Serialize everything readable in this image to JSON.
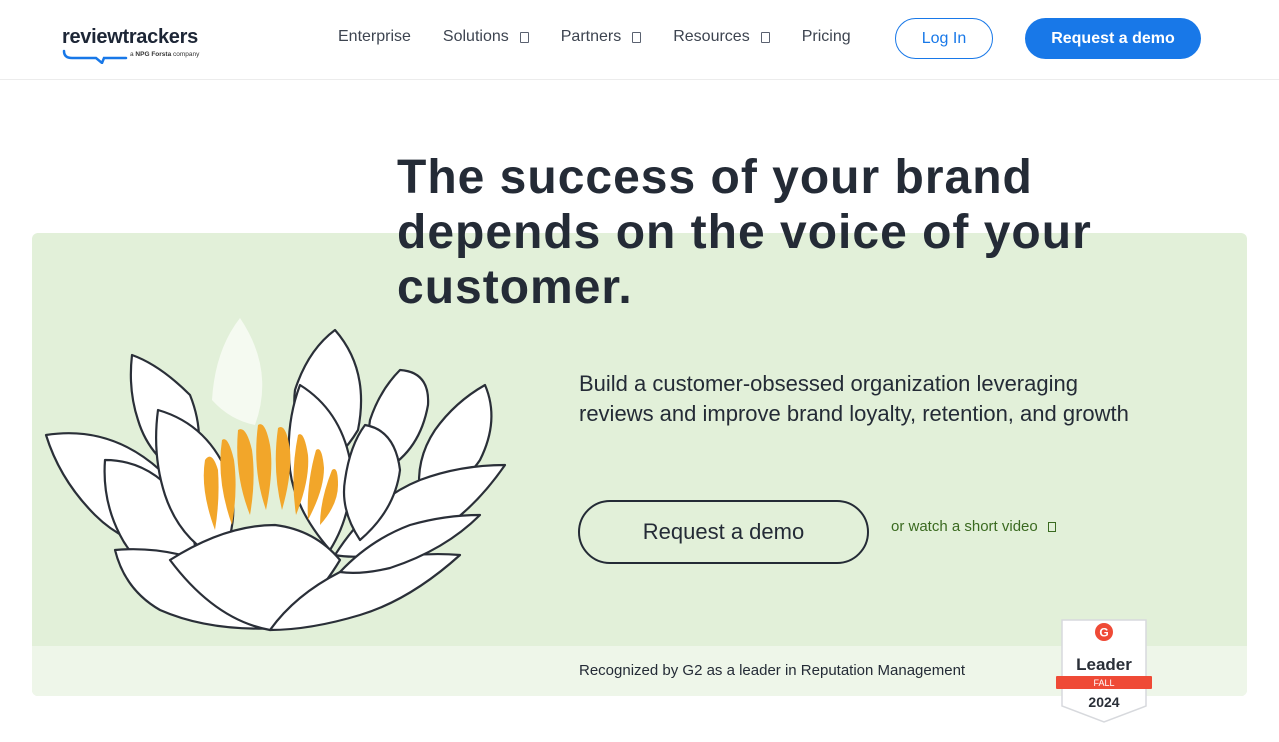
{
  "brand": {
    "name": "reviewtrackers",
    "sub_prefix": "a ",
    "sub_group": "NPG",
    "sub_company": "Forsta",
    "sub_suffix": " company",
    "accent": "#1878e8"
  },
  "nav": {
    "items": [
      {
        "label": "Enterprise",
        "dropdown": false
      },
      {
        "label": "Solutions",
        "dropdown": true
      },
      {
        "label": "Partners",
        "dropdown": true
      },
      {
        "label": "Resources",
        "dropdown": true
      },
      {
        "label": "Pricing",
        "dropdown": false
      }
    ],
    "login_label": "Log In",
    "demo_label": "Request a demo"
  },
  "hero": {
    "headline_lines": [
      "The success of your brand",
      "depends on the voice of your",
      "customer."
    ],
    "subtext": "Build a customer-obsessed organization leveraging reviews and improve brand loyalty, retention, and growth",
    "cta_label": "Request a demo",
    "video_label": "or watch a short video",
    "recognized": "Recognized by G2 as a leader in Reputation Management",
    "background": "#e2f0d9"
  },
  "badge": {
    "logo": "G",
    "title": "Leader",
    "season": "FALL",
    "year": "2024",
    "ribbon_color": "#ef4a36"
  }
}
